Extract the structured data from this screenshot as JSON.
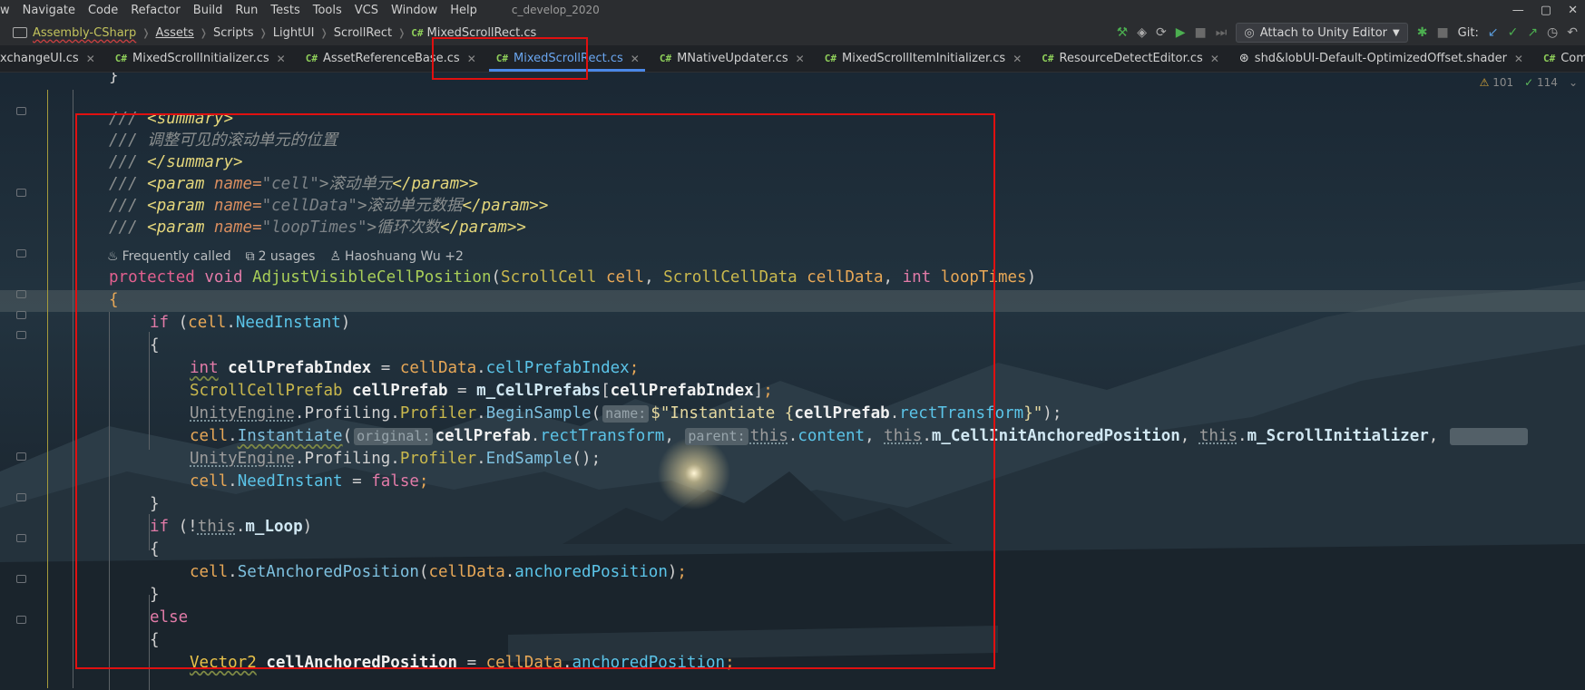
{
  "menu": {
    "items": [
      "w",
      "Navigate",
      "Code",
      "Refactor",
      "Build",
      "Run",
      "Tests",
      "Tools",
      "VCS",
      "Window",
      "Help"
    ],
    "project_name": "c_develop_2020"
  },
  "window_controls": [
    "—",
    "▢",
    "✕"
  ],
  "nav": {
    "project_icon": "solution-icon",
    "breadcrumbs": [
      "Assembly-CSharp",
      "Assets",
      "Scripts",
      "LightUI",
      "ScrollRect",
      "MixedScrollRect.cs"
    ],
    "cs_badge": "C#",
    "attach_label": "Attach to Unity Editor",
    "git_label": "Git:"
  },
  "tabs": [
    {
      "label": "xchangeUI.cs",
      "close": "✕",
      "cs": false,
      "active": false
    },
    {
      "label": "MixedScrollInitializer.cs",
      "close": "✕",
      "cs": true,
      "active": false
    },
    {
      "label": "AssetReferenceBase.cs",
      "close": "✕",
      "cs": true,
      "active": false
    },
    {
      "label": "MixedScrollRect.cs",
      "close": "✕",
      "cs": true,
      "active": true
    },
    {
      "label": "MNativeUpdater.cs",
      "close": "✕",
      "cs": true,
      "active": false
    },
    {
      "label": "MixedScrollItemInitializer.cs",
      "close": "✕",
      "cs": true,
      "active": false
    },
    {
      "label": "ResourceDetectEditor.cs",
      "close": "✕",
      "cs": true,
      "active": false
    },
    {
      "label": "shd&lobUI-Default-OptimizedOffset.shader",
      "close": "✕",
      "cs": false,
      "active": false
    },
    {
      "label": "CommonExchangeUI_ItemTemplate.cs",
      "close": "",
      "cs": true,
      "active": false
    }
  ],
  "inspections": {
    "warnings": "101",
    "ok": "114"
  },
  "code": {
    "brace_close": "}",
    "doc": {
      "slashes": "///",
      "summary_open": "<summary>",
      "summary_text": "调整可见的滚动单元的位置",
      "summary_close": "</summary>",
      "param_open": "<param",
      "param_attr": "name=",
      "param_close_tag": "</param>",
      "p1_name": "\"cell\"",
      "p1_desc": ">滚动单元",
      "p2_name": "\"cellData\"",
      "p2_desc": ">滚动单元数据",
      "p3_name": "\"loopTimes\"",
      "p3_desc": ">循环次数"
    },
    "lens": {
      "frequently": "Frequently called",
      "usages": "2 usages",
      "authors": "Haoshuang Wu +2"
    },
    "sig": {
      "protected": "protected",
      "void": "void",
      "method": "AdjustVisibleCellPosition",
      "t1": "ScrollCell",
      "p1": "cell",
      "t2": "ScrollCellData",
      "p2": "cellData",
      "t3": "int",
      "p3": "loopTimes"
    },
    "body": {
      "if": "if",
      "need_instant": "NeedInstant",
      "int": "int",
      "cell_prefab_index": "cellPrefabIndex",
      "scroll_cell_prefab": "ScrollCellPrefab",
      "cell_prefab": "cellPrefab",
      "m_cell_prefabs": "m_CellPrefabs",
      "unity_engine": "UnityEngine",
      "profiling": "Profiling",
      "profiler": "Profiler",
      "begin_sample": "BeginSample",
      "hint_name": "name:",
      "str_open": "$\"Instantiate {",
      "rect_transform": "rectTransform",
      "str_close": "}\"",
      "instantiate": "Instantiate",
      "hint_original": "original:",
      "hint_parent": "parent:",
      "this": "this",
      "content": "content",
      "m_cell_init": "m_CellInitAnchoredPosition",
      "m_scroll_init": "m_ScrollInitializer",
      "end_sample": "EndSample",
      "false": "false",
      "m_loop": "m_Loop",
      "set_anchored": "SetAnchoredPosition",
      "anchored_position": "anchoredPosition",
      "else": "else",
      "vector2": "Vector2",
      "cell_anchored_position": "cellAnchoredPosition"
    }
  },
  "colors": {
    "highlight_box": "#e01010",
    "active_tab": "#4a88e8"
  }
}
